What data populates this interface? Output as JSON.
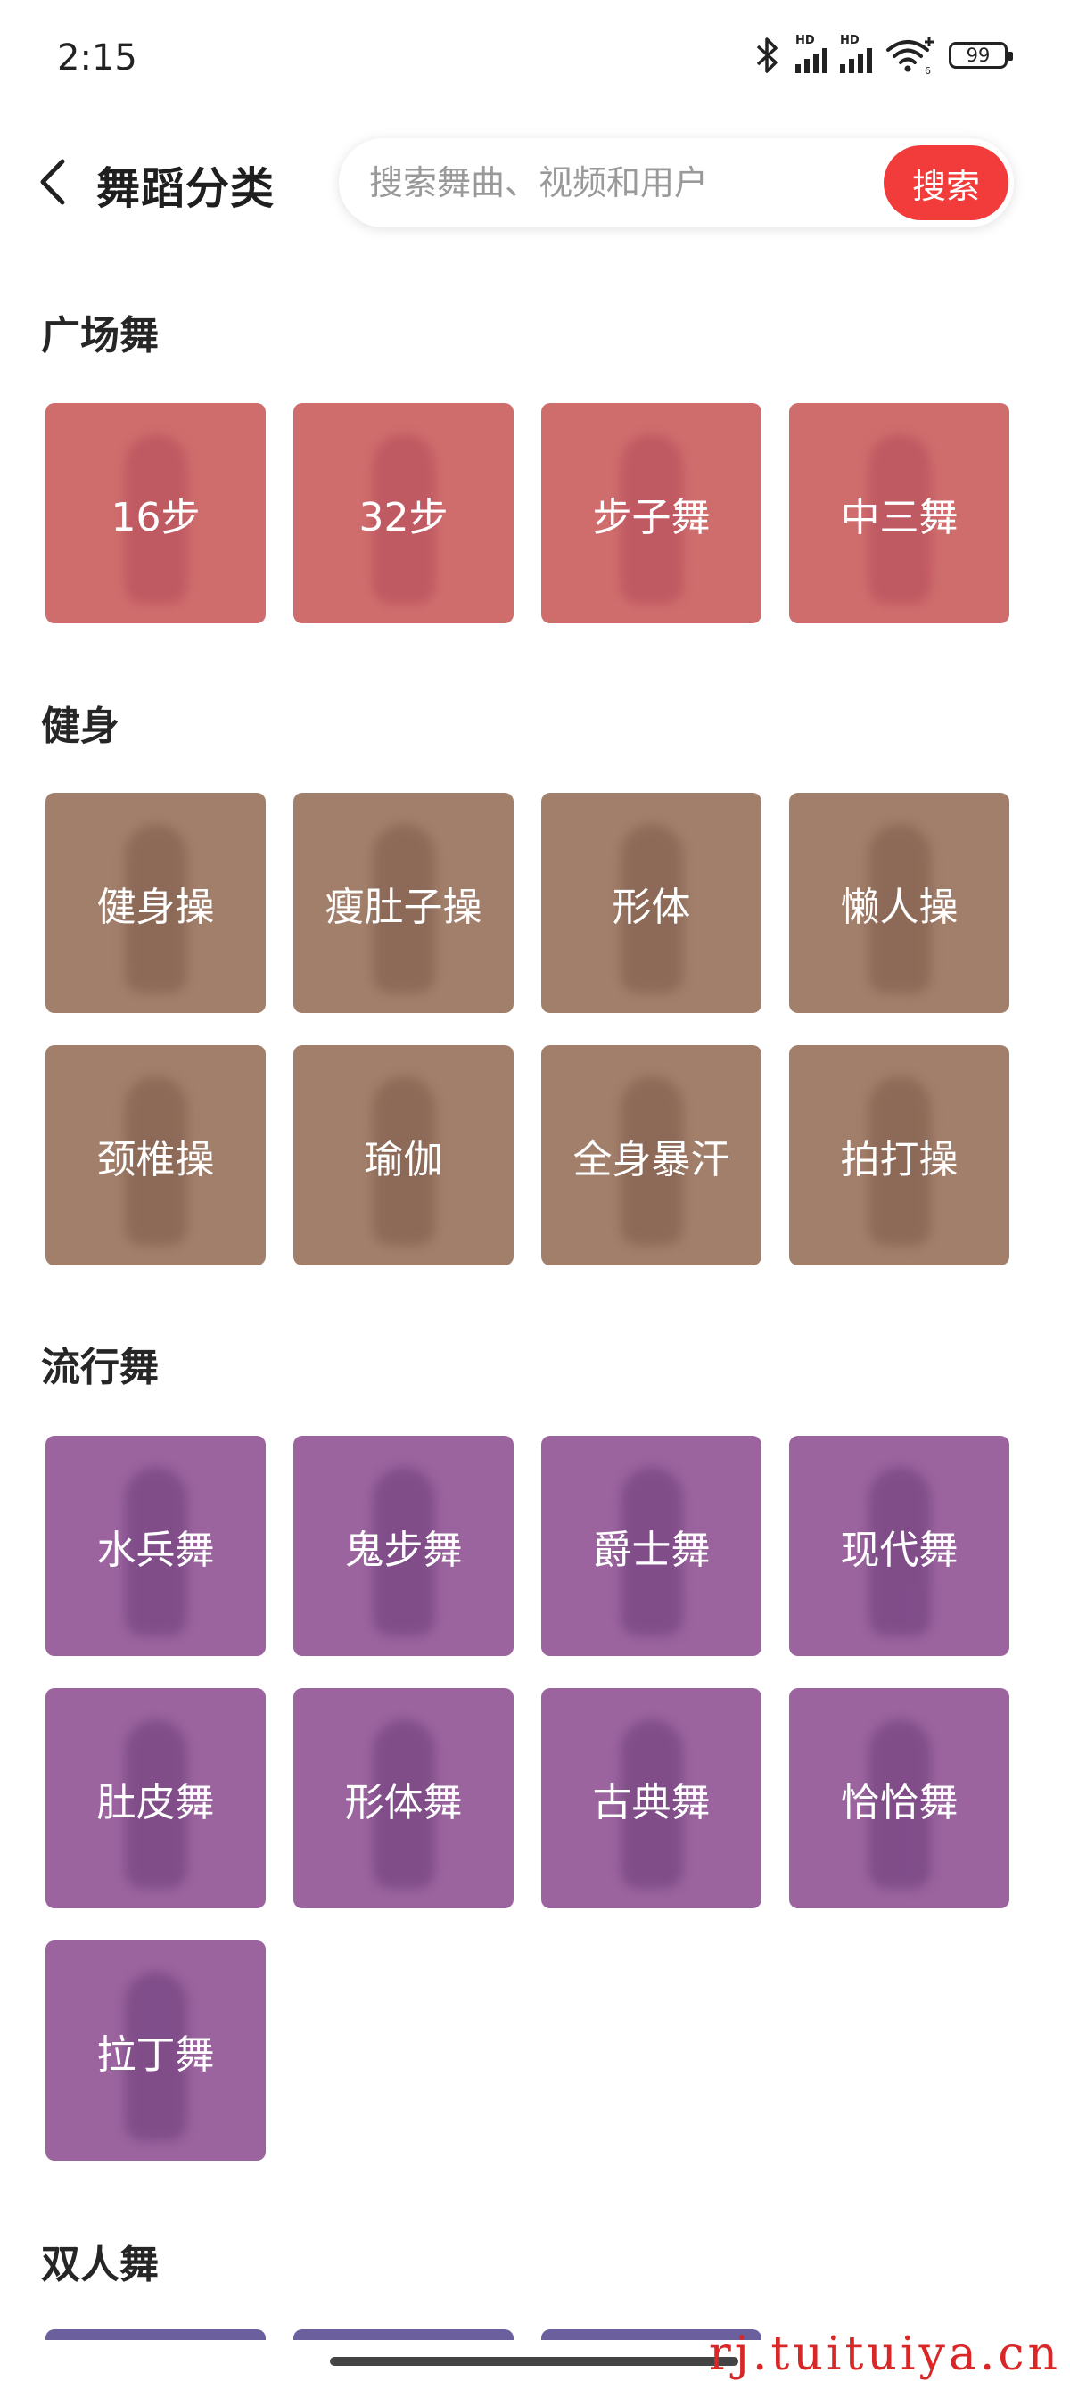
{
  "status_bar": {
    "time": "2:15",
    "signal_1_label": "HD",
    "signal_2_label": "HD",
    "wifi_sub": "6",
    "battery": "99"
  },
  "header": {
    "title": "舞蹈分类",
    "search_placeholder": "搜索舞曲、视频和用户",
    "search_button": "搜索"
  },
  "sections": [
    {
      "title": "广场舞",
      "tiles": [
        "16步",
        "32步",
        "步子舞",
        "中三舞"
      ]
    },
    {
      "title": "健身",
      "tiles": [
        "健身操",
        "瘦肚子操",
        "形体",
        "懒人操",
        "颈椎操",
        "瑜伽",
        "全身暴汗",
        "拍打操"
      ]
    },
    {
      "title": "流行舞",
      "tiles": [
        "水兵舞",
        "鬼步舞",
        "爵士舞",
        "现代舞",
        "肚皮舞",
        "形体舞",
        "古典舞",
        "恰恰舞",
        "拉丁舞"
      ]
    },
    {
      "title": "双人舞",
      "tiles": []
    }
  ],
  "watermark": "rj.tuituiya.cn",
  "colors": {
    "accent": "#f23c3c",
    "square_dance_tile": "#cf6d6d",
    "fitness_tile": "#a27f6b",
    "popular_dance_tile": "#9b649f",
    "couple_dance_tile": "#6b5f9e"
  }
}
